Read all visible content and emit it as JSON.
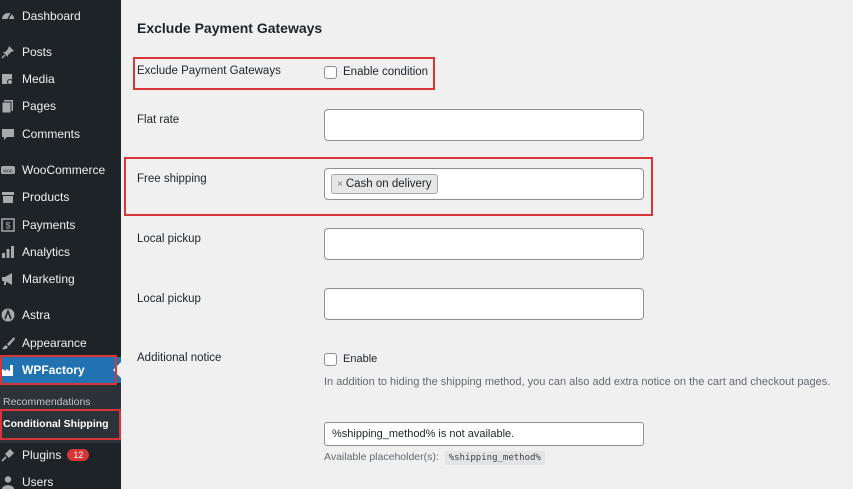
{
  "sidebar": {
    "items": [
      {
        "label": "Dashboard",
        "icon": "dashboard-icon"
      },
      {
        "label": "Posts",
        "icon": "pin-icon"
      },
      {
        "label": "Media",
        "icon": "media-icon"
      },
      {
        "label": "Pages",
        "icon": "pages-icon"
      },
      {
        "label": "Comments",
        "icon": "comment-icon"
      },
      {
        "label": "WooCommerce",
        "icon": "woo-icon"
      },
      {
        "label": "Products",
        "icon": "archive-icon"
      },
      {
        "label": "Payments",
        "icon": "dollar-icon"
      },
      {
        "label": "Analytics",
        "icon": "bar-chart-icon"
      },
      {
        "label": "Marketing",
        "icon": "megaphone-icon"
      },
      {
        "label": "Astra",
        "icon": "astra-icon"
      },
      {
        "label": "Appearance",
        "icon": "brush-icon"
      },
      {
        "label": "WPFactory",
        "icon": "factory-icon"
      },
      {
        "label": "Plugins",
        "icon": "plug-icon",
        "badge": "12"
      },
      {
        "label": "Users",
        "icon": "user-icon"
      }
    ],
    "submenu": {
      "heading": "Recommendations",
      "active_item": "Conditional Shipping"
    },
    "active_color": "#2271b1",
    "highlight_color": "#d63638"
  },
  "main": {
    "section_title": "Exclude Payment Gateways",
    "rows": {
      "exclude": {
        "label": "Exclude Payment Gateways",
        "checkbox_label": "Enable condition"
      },
      "flat_rate": {
        "label": "Flat rate",
        "value": ""
      },
      "free_shipping": {
        "label": "Free shipping",
        "chips": [
          "Cash on delivery"
        ],
        "chip_remove": "×"
      },
      "local_pickup_1": {
        "label": "Local pickup",
        "value": ""
      },
      "local_pickup_2": {
        "label": "Local pickup",
        "value": ""
      },
      "notice": {
        "label": "Additional notice",
        "checkbox_label": "Enable",
        "help": "In addition to hiding the shipping method, you can also add extra notice on the cart and checkout pages.",
        "value": "%shipping_method% is not available.",
        "placeholder_prefix": "Available placeholder(s):",
        "placeholder_code": "%shipping_method%"
      }
    }
  }
}
